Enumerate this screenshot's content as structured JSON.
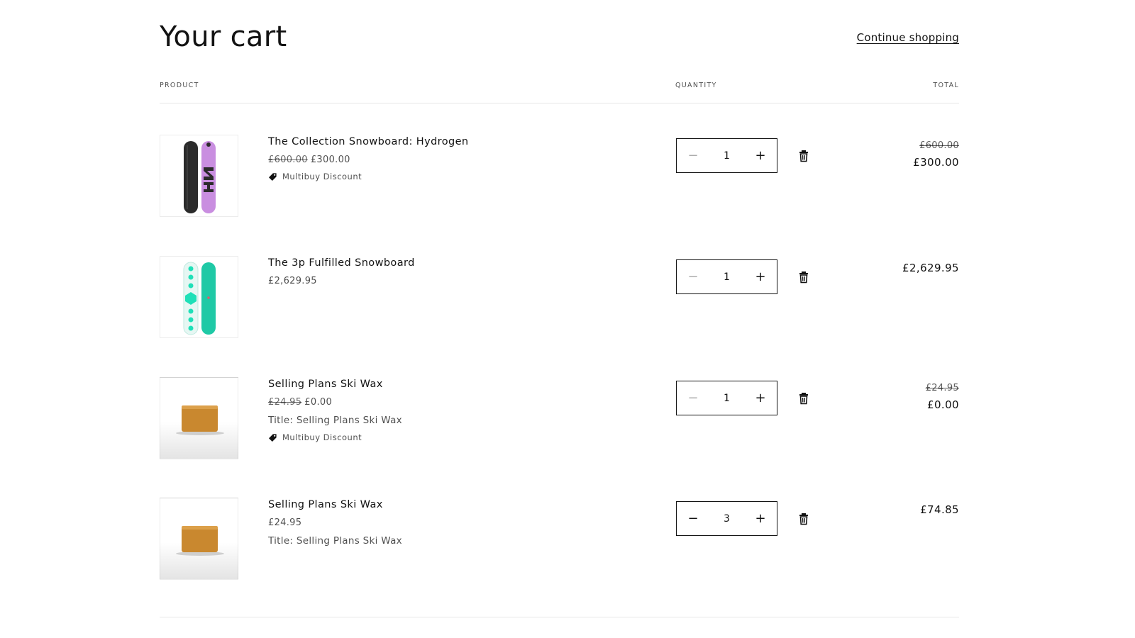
{
  "header": {
    "title": "Your cart",
    "continue_label": "Continue shopping"
  },
  "columns": {
    "product": "PRODUCT",
    "quantity": "QUANTITY",
    "total": "TOTAL"
  },
  "items": [
    {
      "name": "The Collection Snowboard: Hydrogen",
      "price_original": "£600.00",
      "price": "£300.00",
      "option": "",
      "discount": "Multibuy Discount",
      "quantity": "1",
      "total_original": "£600.00",
      "total": "£300.00",
      "image": "snowboard-hydrogen",
      "minus_disabled": true
    },
    {
      "name": "The 3p Fulfilled Snowboard",
      "price_original": "",
      "price": "£2,629.95",
      "option": "",
      "discount": "",
      "quantity": "1",
      "total_original": "",
      "total": "£2,629.95",
      "image": "snowboard-teal",
      "minus_disabled": true
    },
    {
      "name": "Selling Plans Ski Wax",
      "price_original": "£24.95",
      "price": "£0.00",
      "option": "Title: Selling Plans Ski Wax",
      "discount": "Multibuy Discount",
      "quantity": "1",
      "total_original": "£24.95",
      "total": "£0.00",
      "image": "ski-wax",
      "minus_disabled": true
    },
    {
      "name": "Selling Plans Ski Wax",
      "price_original": "",
      "price": "£24.95",
      "option": "Title: Selling Plans Ski Wax",
      "discount": "",
      "quantity": "3",
      "total_original": "",
      "total": "£74.85",
      "image": "ski-wax",
      "minus_disabled": false
    }
  ],
  "controls": {
    "minus": "−",
    "plus": "+"
  },
  "icons": {
    "remove": "trash-icon",
    "discount": "tag-icon"
  },
  "colors": {
    "text": "#121212",
    "border": "#121212",
    "hydrogen_board_dark": "#2b2b2b",
    "hydrogen_board_purple": "#c98ee0",
    "teal_board": "#1fc9a6",
    "wax": "#c9882f"
  }
}
